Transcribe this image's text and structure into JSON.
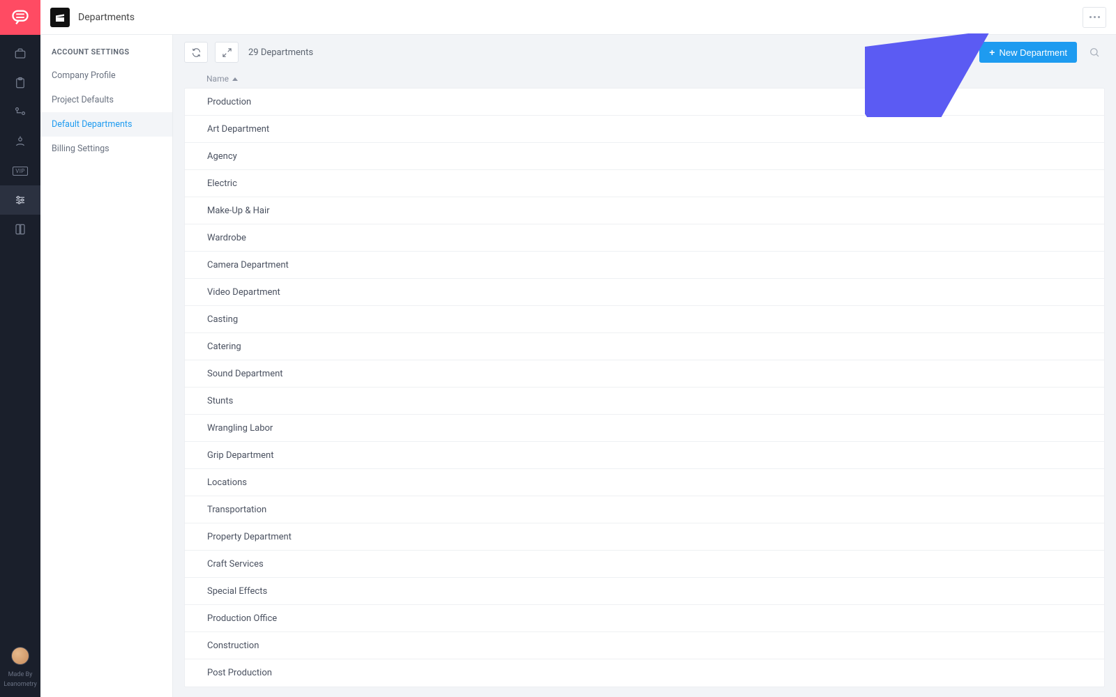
{
  "header": {
    "page_title": "Departments"
  },
  "more_menu": {
    "icon": "more-horizontal"
  },
  "subnav": {
    "title": "ACCOUNT SETTINGS",
    "items": [
      {
        "label": "Company Profile",
        "active": false
      },
      {
        "label": "Project Defaults",
        "active": false
      },
      {
        "label": "Default Departments",
        "active": true
      },
      {
        "label": "Billing Settings",
        "active": false
      }
    ]
  },
  "toolbar": {
    "count_label": "29 Departments",
    "new_button_label": "New Department"
  },
  "table": {
    "column_header": "Name",
    "sort_direction": "asc",
    "rows": [
      "Production",
      "Art Department",
      "Agency",
      "Electric",
      "Make-Up & Hair",
      "Wardrobe",
      "Camera Department",
      "Video Department",
      "Casting",
      "Catering",
      "Sound Department",
      "Stunts",
      "Wrangling Labor",
      "Grip Department",
      "Locations",
      "Transportation",
      "Property Department",
      "Craft Services",
      "Special Effects",
      "Production Office",
      "Construction",
      "Post Production"
    ]
  },
  "rail": {
    "items": [
      {
        "name": "projects",
        "icon": "briefcase"
      },
      {
        "name": "tasks",
        "icon": "clipboard"
      },
      {
        "name": "team",
        "icon": "users-flow"
      },
      {
        "name": "contacts",
        "icon": "contact"
      },
      {
        "name": "vip",
        "icon": "vip-badge"
      },
      {
        "name": "settings",
        "icon": "sliders",
        "active": true
      },
      {
        "name": "docs",
        "icon": "book"
      }
    ]
  },
  "footer": {
    "made_by_label": "Made By",
    "brand": "Leanometry"
  },
  "colors": {
    "accent": "#1e9bf0",
    "brand": "#ff4b63",
    "arrow": "#5b5bf3"
  }
}
